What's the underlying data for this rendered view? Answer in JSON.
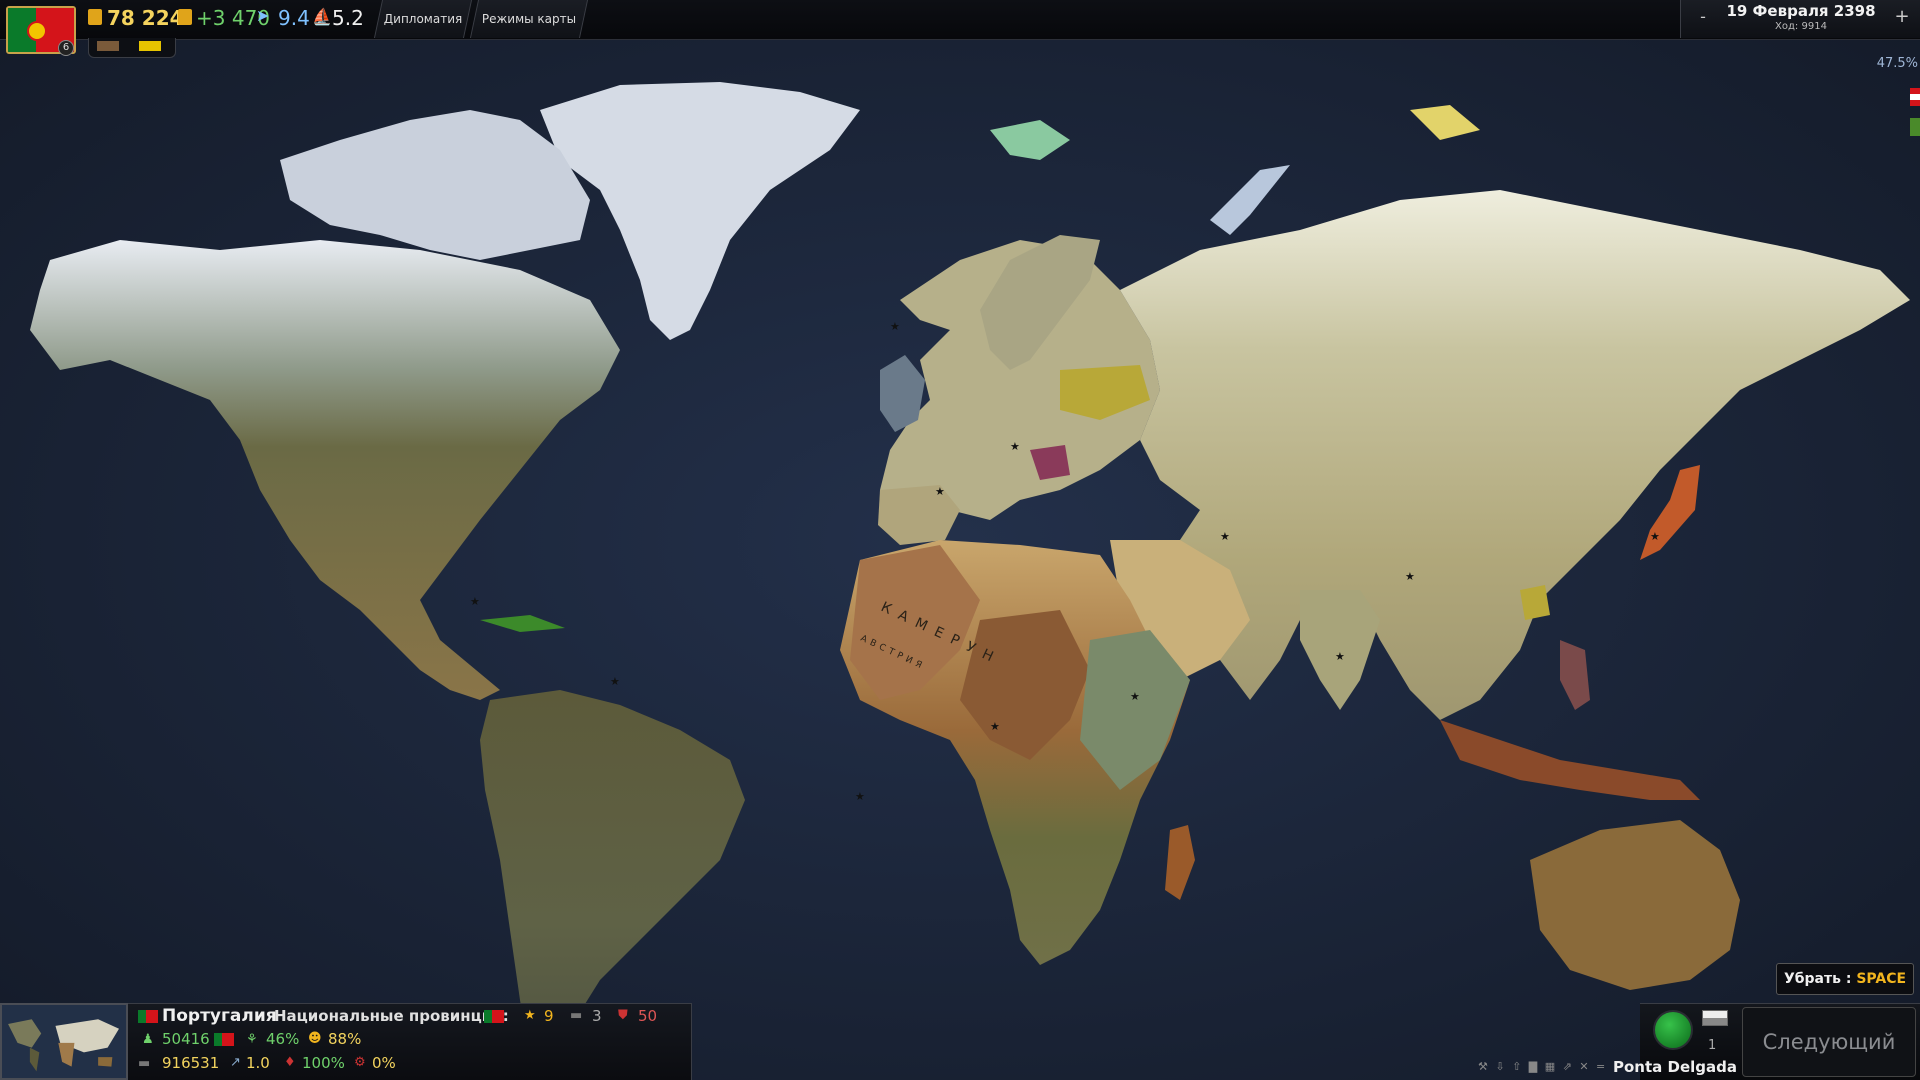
{
  "top_bar": {
    "gold": "78 224",
    "income": "+3 470",
    "speed": "9.4",
    "ships": "5.2",
    "flag_badge": "6",
    "diplomacy_label": "Дипломатия",
    "map_modes_label": "Режимы карты",
    "date": "19 Февраля 2398",
    "turn": "Ход: 9914",
    "minus_label": "-",
    "plus_label": "+",
    "zoom": "47.5%"
  },
  "map": {
    "labels": [
      "КАМЕРУН",
      "АВСТРИЯ"
    ]
  },
  "country_panel": {
    "name": "Португалия",
    "national_provinces_label": "Национальные провинции:",
    "stars": "9",
    "units": "3",
    "losses": "50",
    "population": "50416",
    "growth": "46%",
    "happiness": "88%",
    "army": "916531",
    "tech": "1.0",
    "morale": "100%",
    "other": "0%"
  },
  "bottom_right": {
    "hide_label": "Убрать : ",
    "hide_key": "SPACE",
    "unit_count": "1",
    "next_turn_label": "Следующий ход",
    "province_name": "Ponta Delgada",
    "toolbar_icons": "⚒ ⇩ ⇧ ▇ ▦ ⇗ ✕ ="
  },
  "colors": {
    "ocean": "#1d2738",
    "gold": "#f4d35e",
    "income": "#6fd16b",
    "speed": "#7fc1ff",
    "accent_key": "#f2b51e"
  },
  "icons": [
    "portugal-flag",
    "gold-coin-icon",
    "income-icon",
    "speed-icon",
    "ship-icon",
    "star-icon",
    "tank-icon",
    "shield-icon",
    "population-icon",
    "growth-icon",
    "happiness-icon",
    "army-icon",
    "tech-icon",
    "morale-icon",
    "status-dot-icon"
  ]
}
